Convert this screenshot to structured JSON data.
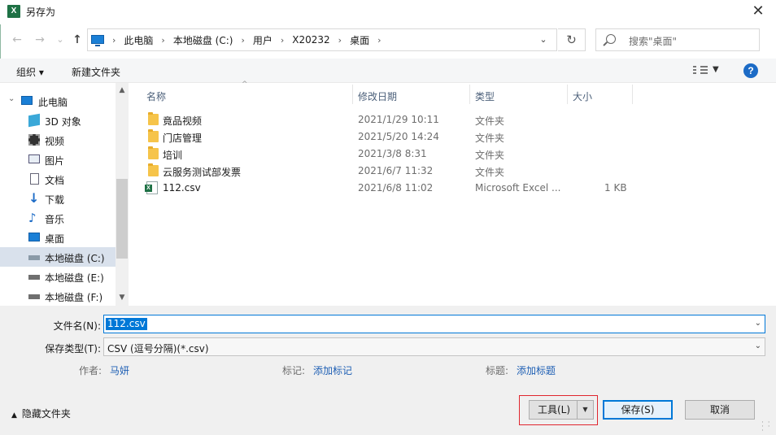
{
  "window": {
    "title": "另存为",
    "app_icon_letter": "X"
  },
  "nav": {
    "back": "←",
    "forward": "→",
    "recent": "⌄",
    "up": "↑"
  },
  "address": {
    "crumbs": [
      "此电脑",
      "本地磁盘 (C:)",
      "用户",
      "X20232",
      "桌面"
    ],
    "refresh": "↻"
  },
  "search": {
    "placeholder": "搜索\"桌面\""
  },
  "toolbar": {
    "organize_label": "组织 ▾",
    "new_folder_label": "新建文件夹",
    "help": "?"
  },
  "sidebar": {
    "items": [
      {
        "label": "此电脑",
        "icon": "computer-icon",
        "root": true
      },
      {
        "label": "3D 对象",
        "icon": "3d-objects-icon"
      },
      {
        "label": "视频",
        "icon": "video-icon"
      },
      {
        "label": "图片",
        "icon": "pictures-icon"
      },
      {
        "label": "文档",
        "icon": "documents-icon"
      },
      {
        "label": "下载",
        "icon": "downloads-icon"
      },
      {
        "label": "音乐",
        "icon": "music-icon"
      },
      {
        "label": "桌面",
        "icon": "desktop-icon"
      },
      {
        "label": "本地磁盘 (C:)",
        "icon": "drive-icon",
        "selected": true
      },
      {
        "label": "本地磁盘 (E:)",
        "icon": "drive-icon"
      },
      {
        "label": "本地磁盘 (F:)",
        "icon": "drive-icon"
      }
    ]
  },
  "files": {
    "columns": [
      "名称",
      "修改日期",
      "类型",
      "大小"
    ],
    "rows": [
      {
        "name": "竟品视频",
        "date": "2021/1/29 10:11",
        "type": "文件夹",
        "size": "",
        "kind": "folder"
      },
      {
        "name": "门店管理",
        "date": "2021/5/20 14:24",
        "type": "文件夹",
        "size": "",
        "kind": "folder"
      },
      {
        "name": "培训",
        "date": "2021/3/8 8:31",
        "type": "文件夹",
        "size": "",
        "kind": "folder"
      },
      {
        "name": "云服务测试部发票",
        "date": "2021/6/7 11:32",
        "type": "文件夹",
        "size": "",
        "kind": "folder"
      },
      {
        "name": "112.csv",
        "date": "2021/6/8 11:02",
        "type": "Microsoft Excel ...",
        "size": "1 KB",
        "kind": "csv"
      }
    ]
  },
  "form": {
    "filename_label": "文件名(N):",
    "filename_value": "112.csv",
    "filetype_label": "保存类型(T):",
    "filetype_value": "CSV (逗号分隔)(*.csv)",
    "author_label": "作者:",
    "author_value": "马妍",
    "tags_label": "标记:",
    "tags_value": "添加标记",
    "title_label": "标题:",
    "title_value": "添加标题"
  },
  "footer": {
    "hide_folders_label": "隐藏文件夹",
    "tools_label": "工具(L)",
    "save_label": "保存(S)",
    "cancel_label": "取消"
  },
  "colors": {
    "accent": "#0078d7",
    "highlight_box": "#e0262f",
    "excel_green": "#1e7145"
  }
}
